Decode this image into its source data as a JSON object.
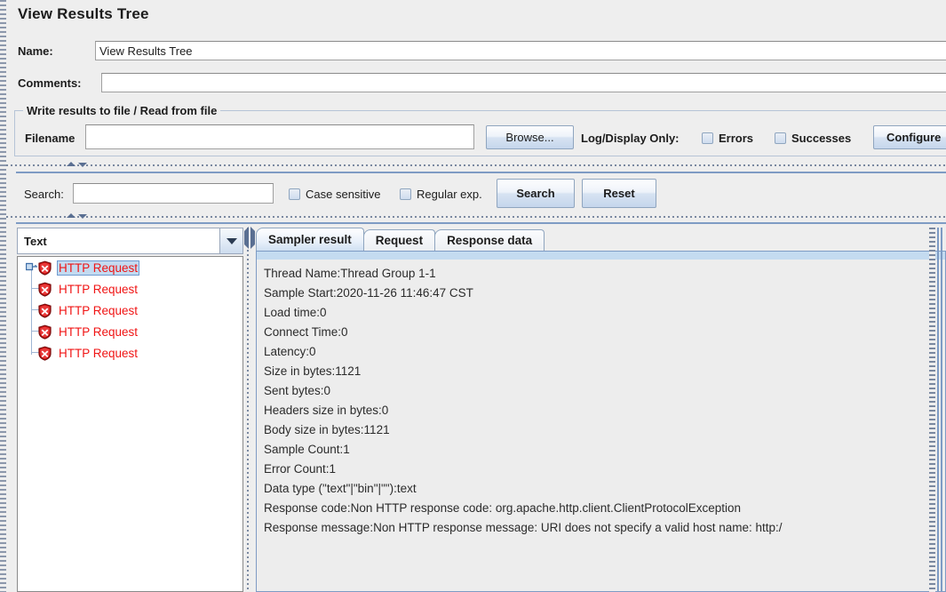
{
  "page": {
    "title": "View Results Tree"
  },
  "form": {
    "name_label": "Name:",
    "name_value": "View Results Tree",
    "comments_label": "Comments:",
    "comments_value": "",
    "comments_placeholder": ""
  },
  "file_group": {
    "title": "Write results to file / Read from file",
    "filename_label": "Filename",
    "filename_value": "",
    "filename_placeholder": "",
    "browse_label": "Browse...",
    "log_display_label": "Log/Display Only:",
    "errors_label": "Errors",
    "errors_checked": false,
    "successes_label": "Successes",
    "successes_checked": false,
    "configure_label": "Configure"
  },
  "search_bar": {
    "search_label": "Search:",
    "search_value": "",
    "search_placeholder": "",
    "case_sensitive_label": "Case sensitive",
    "case_sensitive_checked": false,
    "regular_exp_label": "Regular exp.",
    "regular_exp_checked": false,
    "search_button": "Search",
    "reset_button": "Reset"
  },
  "tree_panel": {
    "renderer_selected": "Text",
    "nodes": [
      {
        "label": "HTTP Request",
        "status": "error",
        "selected": true
      },
      {
        "label": "HTTP Request",
        "status": "error",
        "selected": false
      },
      {
        "label": "HTTP Request",
        "status": "error",
        "selected": false
      },
      {
        "label": "HTTP Request",
        "status": "error",
        "selected": false
      },
      {
        "label": "HTTP Request",
        "status": "error",
        "selected": false
      }
    ]
  },
  "results_panel": {
    "tabs": [
      {
        "label": "Sampler result",
        "active": true
      },
      {
        "label": "Request",
        "active": false
      },
      {
        "label": "Response data",
        "active": false
      }
    ],
    "sampler_result_lines": [
      "Thread Name:Thread Group 1-1",
      "Sample Start:2020-11-26 11:46:47 CST",
      "Load time:0",
      "Connect Time:0",
      "Latency:0",
      "Size in bytes:1121",
      "Sent bytes:0",
      "Headers size in bytes:0",
      "Body size in bytes:1121",
      "Sample Count:1",
      "Error Count:1",
      "Data type (\"text\"|\"bin\"|\"\"):text",
      "Response code:Non HTTP response code: org.apache.http.client.ClientProtocolException",
      "Response message:Non HTTP response message: URI does not specify a valid host name: http:/"
    ]
  },
  "colors": {
    "error_red": "#f01414",
    "selection_blue": "#c3daf0",
    "panel_bg": "#eeeeee",
    "accent_border": "#7e9bc4"
  }
}
